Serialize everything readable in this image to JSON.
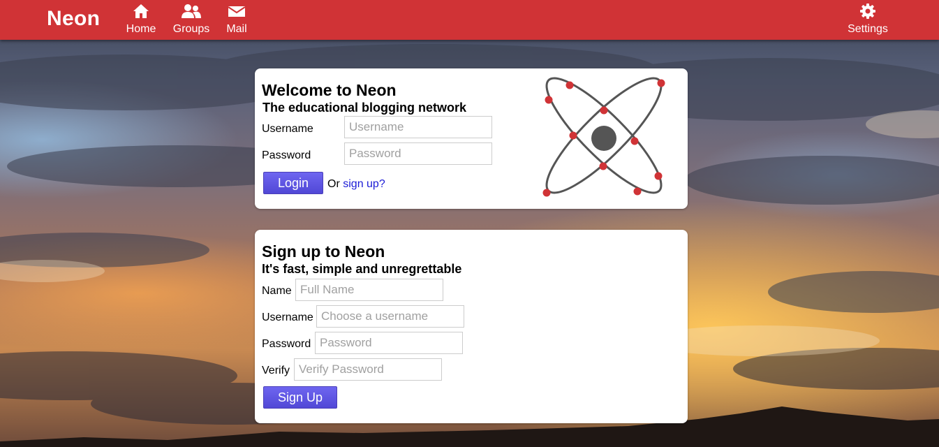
{
  "nav": {
    "brand": "Neon",
    "items": [
      {
        "label": "Home",
        "icon": "home-icon"
      },
      {
        "label": "Groups",
        "icon": "users-icon"
      },
      {
        "label": "Mail",
        "icon": "mail-icon"
      }
    ],
    "settings": {
      "label": "Settings",
      "icon": "gear-icon"
    }
  },
  "login": {
    "title": "Welcome to Neon",
    "subtitle": "The educational blogging network",
    "username_label": "Username",
    "username_placeholder": "Username",
    "password_label": "Password",
    "password_placeholder": "Password",
    "login_button": "Login",
    "or_text": "Or",
    "signup_link": "sign up?",
    "logo": "atom-logo"
  },
  "signup": {
    "title": "Sign up to Neon",
    "subtitle": "It's fast, simple and unregrettable",
    "name_label": "Name",
    "name_placeholder": "Full Name",
    "username_label": "Username",
    "username_placeholder": "Choose a username",
    "password_label": "Password",
    "password_placeholder": "Password",
    "verify_label": "Verify",
    "verify_placeholder": "Verify Password",
    "signup_button": "Sign Up"
  },
  "colors": {
    "navbar": "#d03336",
    "button": "#5a52e0",
    "link": "#1b1bd6",
    "logo_dots": "#d03336",
    "logo_lines": "#555555"
  }
}
